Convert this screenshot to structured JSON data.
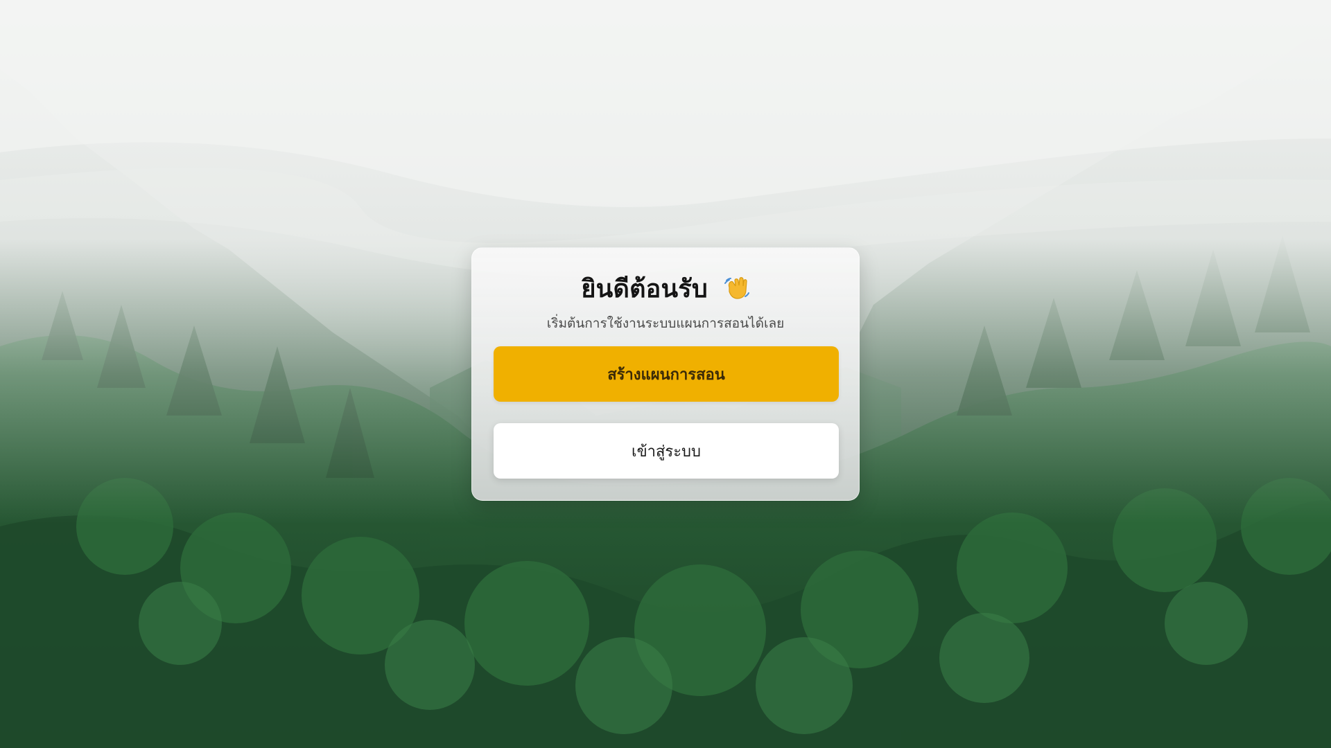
{
  "welcome": {
    "title": "ยินดีต้อนรับ",
    "wave_icon": "waving-hand-icon",
    "subtitle": "เริ่มต้นการใช้งานระบบแผนการสอนได้เลย"
  },
  "actions": {
    "create_plan_label": "สร้างแผนการสอน",
    "login_label": "เข้าสู่ระบบ"
  },
  "colors": {
    "primary": "#f0b000",
    "card": "#f2f2f2",
    "forest": "#1f4a2d"
  }
}
